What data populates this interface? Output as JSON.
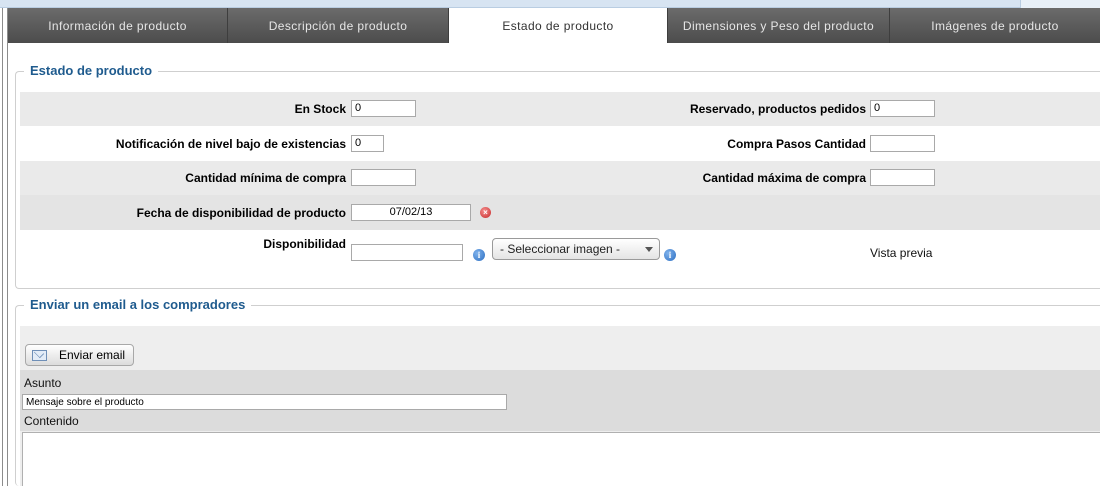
{
  "tabs": [
    {
      "label": "Información de producto",
      "active": false
    },
    {
      "label": "Descripción de producto",
      "active": false
    },
    {
      "label": "Estado de producto",
      "active": true
    },
    {
      "label": "Dimensiones y Peso del producto",
      "active": false
    },
    {
      "label": "Imágenes de producto",
      "active": false
    }
  ],
  "stock_section": {
    "legend": "Estado de producto",
    "in_stock": {
      "label": "En Stock",
      "value": "0"
    },
    "reserved": {
      "label": "Reservado, productos pedidos",
      "value": "0"
    },
    "low_stock_notification": {
      "label": "Notificación de nivel bajo de existencias",
      "value": "0"
    },
    "purchase_steps": {
      "label": "Compra Pasos Cantidad",
      "value": ""
    },
    "min_purchase": {
      "label": "Cantidad mínima de compra",
      "value": ""
    },
    "max_purchase": {
      "label": "Cantidad máxima de compra",
      "value": ""
    },
    "availability_date": {
      "label": "Fecha de disponibilidad de producto",
      "value": "07/02/13"
    },
    "availability": {
      "label": "Disponibilidad",
      "value": ""
    },
    "image_select": {
      "selected": "- Seleccionar imagen -"
    },
    "preview_label": "Vista previa"
  },
  "email_section": {
    "legend": "Enviar un email a los compradores",
    "send_button": "Enviar email",
    "subject_label": "Asunto",
    "subject_value": "Mensaje sobre el producto",
    "content_label": "Contenido",
    "content_value": ""
  },
  "colors": {
    "legend": "#1f5b8e",
    "tabbar": "#555555",
    "row_gray": "#eaeaea",
    "info_icon": "#2d6fc2",
    "error_icon": "#c62828"
  },
  "icons": [
    "info-icon",
    "clear-date-icon",
    "envelope-icon",
    "dropdown-arrow-icon"
  ]
}
